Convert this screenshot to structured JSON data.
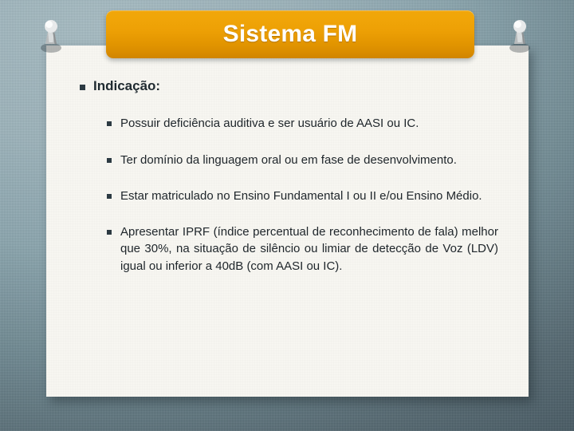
{
  "slide": {
    "title": "Sistema FM",
    "heading": {
      "bullet_icon": "square-bullet-icon",
      "label": "Indicação:"
    },
    "items": [
      {
        "bullet_icon": "square-bullet-icon",
        "text": "Possuir deficiência auditiva e ser usuário de AASI ou IC."
      },
      {
        "bullet_icon": "square-bullet-icon",
        "text": "Ter domínio da linguagem oral ou em fase de desenvolvimento."
      },
      {
        "bullet_icon": "square-bullet-icon",
        "text": "Estar matriculado no Ensino Fundamental I ou II e/ou Ensino Médio."
      },
      {
        "bullet_icon": "square-bullet-icon",
        "text": "Apresentar IPRF (índice percentual de reconhecimento de fala) melhor que 30%, na situação de silêncio ou limiar de detecção de Voz (LDV) igual ou inferior a 40dB (com AASI ou IC)."
      }
    ],
    "decorations": {
      "left_pin_icon": "pushpin-icon",
      "right_pin_icon": "pushpin-icon"
    },
    "colors": {
      "title_banner_top": "#f1a70a",
      "title_banner_bottom": "#d08400",
      "title_text": "#ffffff",
      "paper": "#f7f6f1",
      "body_text": "#20272c",
      "background_light": "#a6bcc3",
      "background_dark": "#3d4f58"
    }
  }
}
